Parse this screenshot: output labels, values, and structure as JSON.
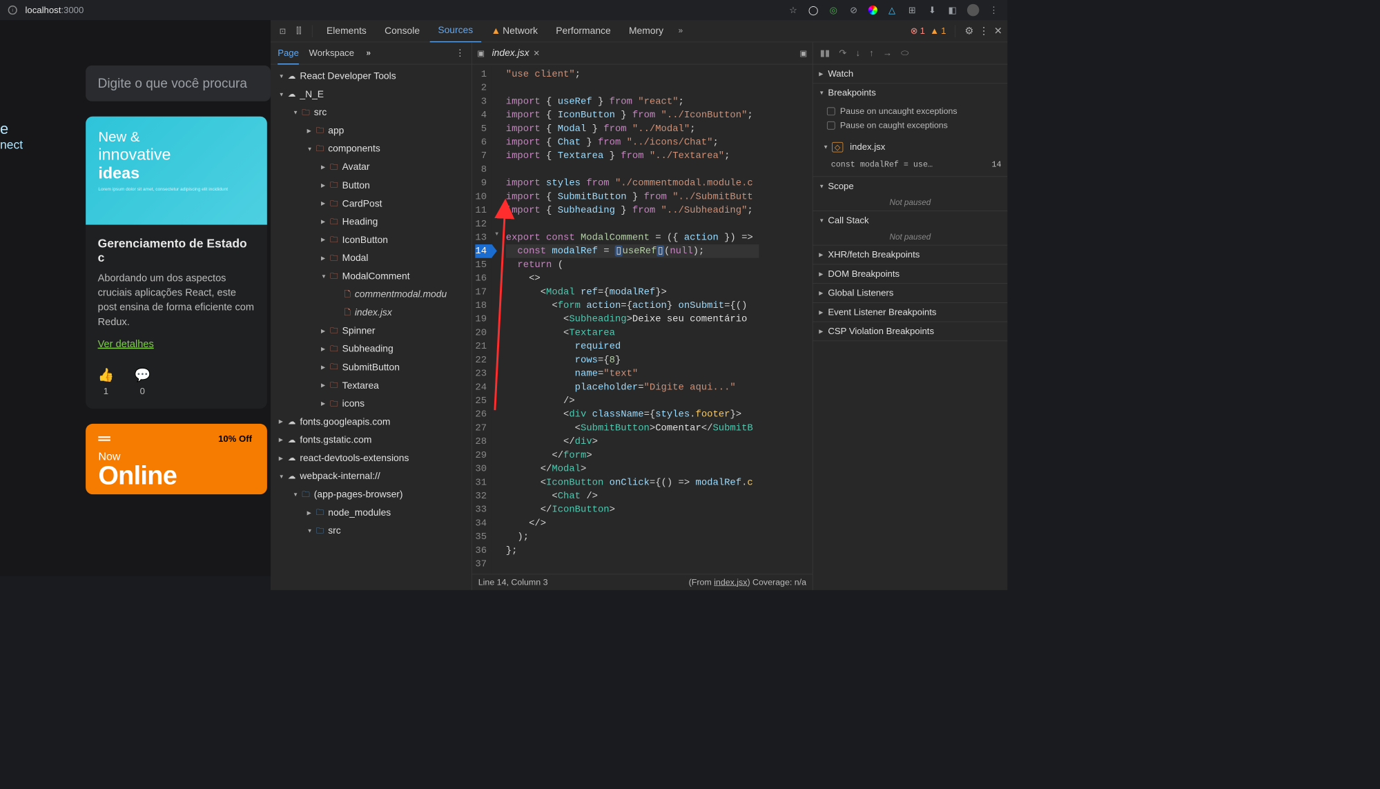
{
  "browser": {
    "url_host": "localhost",
    "url_port": ":3000",
    "icons": [
      "star",
      "circle",
      "target",
      "compass",
      "rgb",
      "triangle",
      "puzzle",
      "download",
      "panel",
      "avatar",
      "dots"
    ]
  },
  "page": {
    "logo_line1": "e",
    "logo_line2": "nect",
    "search_placeholder": "Digite o que você procura",
    "card1": {
      "hero_kicker": "New &",
      "hero_title_light": "innovative",
      "hero_title_bold": "ideas",
      "hero_fine": "Lorem ipsum dolor sit amet, consectetur adipiscing elit incididunt",
      "title": "Gerenciamento de Estado c",
      "body": "Abordando um dos aspectos cruciais aplicações React, este post ensina de forma eficiente com Redux.",
      "link": "Ver detalhes",
      "likes": "1",
      "comments": "0"
    },
    "card2": {
      "badge": "10% Off",
      "label": "Now",
      "big": "Online"
    }
  },
  "devtools": {
    "tabs": [
      "Elements",
      "Console",
      "Sources",
      "Network",
      "Performance",
      "Memory"
    ],
    "active_tab": "Sources",
    "network_warn": true,
    "errors": "1",
    "warnings": "1",
    "nav": {
      "tabs": [
        "Page",
        "Workspace"
      ],
      "active": "Page",
      "tree": [
        {
          "indent": 0,
          "open": true,
          "icon": "cloud",
          "label": "React Developer Tools"
        },
        {
          "indent": 0,
          "open": true,
          "icon": "cloud",
          "label": "_N_E"
        },
        {
          "indent": 1,
          "open": true,
          "icon": "folder",
          "label": "src"
        },
        {
          "indent": 2,
          "open": false,
          "icon": "folder",
          "label": "app"
        },
        {
          "indent": 2,
          "open": true,
          "icon": "folder",
          "label": "components"
        },
        {
          "indent": 3,
          "open": false,
          "icon": "folder",
          "label": "Avatar"
        },
        {
          "indent": 3,
          "open": false,
          "icon": "folder",
          "label": "Button"
        },
        {
          "indent": 3,
          "open": false,
          "icon": "folder",
          "label": "CardPost"
        },
        {
          "indent": 3,
          "open": false,
          "icon": "folder",
          "label": "Heading"
        },
        {
          "indent": 3,
          "open": false,
          "icon": "folder",
          "label": "IconButton"
        },
        {
          "indent": 3,
          "open": false,
          "icon": "folder",
          "label": "Modal"
        },
        {
          "indent": 3,
          "open": true,
          "icon": "folder",
          "label": "ModalComment"
        },
        {
          "indent": 4,
          "open": null,
          "icon": "file",
          "label": "commentmodal.modu",
          "ital": true
        },
        {
          "indent": 4,
          "open": null,
          "icon": "file",
          "label": "index.jsx",
          "ital": true
        },
        {
          "indent": 3,
          "open": false,
          "icon": "folder",
          "label": "Spinner"
        },
        {
          "indent": 3,
          "open": false,
          "icon": "folder",
          "label": "Subheading"
        },
        {
          "indent": 3,
          "open": false,
          "icon": "folder",
          "label": "SubmitButton"
        },
        {
          "indent": 3,
          "open": false,
          "icon": "folder",
          "label": "Textarea"
        },
        {
          "indent": 3,
          "open": false,
          "icon": "folder",
          "label": "icons"
        },
        {
          "indent": 0,
          "open": false,
          "icon": "cloud",
          "label": "fonts.googleapis.com"
        },
        {
          "indent": 0,
          "open": false,
          "icon": "cloud",
          "label": "fonts.gstatic.com"
        },
        {
          "indent": 0,
          "open": false,
          "icon": "cloud",
          "label": "react-devtools-extensions"
        },
        {
          "indent": 0,
          "open": true,
          "icon": "cloud",
          "label": "webpack-internal://"
        },
        {
          "indent": 1,
          "open": true,
          "icon": "folder-outline",
          "label": "(app-pages-browser)"
        },
        {
          "indent": 2,
          "open": false,
          "icon": "folder-outline",
          "label": "node_modules"
        },
        {
          "indent": 2,
          "open": true,
          "icon": "folder-outline",
          "label": "src"
        }
      ]
    },
    "editor": {
      "filename": "index.jsx",
      "status_left": "Line 14, Column 3",
      "status_right_prefix": "(From ",
      "status_right_link": "index.jsx",
      "status_right_suffix": ") Coverage: n/a",
      "breakpoint_line": 14,
      "fold_line": 13,
      "lines": [
        [
          {
            "t": "\"use client\"",
            "c": "str"
          },
          {
            "t": ";",
            "c": "punc"
          }
        ],
        [],
        [
          {
            "t": "import",
            "c": "kw"
          },
          {
            "t": " { ",
            "c": "punc"
          },
          {
            "t": "useRef",
            "c": "id"
          },
          {
            "t": " } ",
            "c": "punc"
          },
          {
            "t": "from",
            "c": "kw"
          },
          {
            "t": " ",
            "c": ""
          },
          {
            "t": "\"react\"",
            "c": "str"
          },
          {
            "t": ";",
            "c": "punc"
          }
        ],
        [
          {
            "t": "import",
            "c": "kw"
          },
          {
            "t": " { ",
            "c": "punc"
          },
          {
            "t": "IconButton",
            "c": "id"
          },
          {
            "t": " } ",
            "c": "punc"
          },
          {
            "t": "from",
            "c": "kw"
          },
          {
            "t": " ",
            "c": ""
          },
          {
            "t": "\"../IconButton\"",
            "c": "str"
          },
          {
            "t": ";",
            "c": "punc"
          }
        ],
        [
          {
            "t": "import",
            "c": "kw"
          },
          {
            "t": " { ",
            "c": "punc"
          },
          {
            "t": "Modal",
            "c": "id"
          },
          {
            "t": " } ",
            "c": "punc"
          },
          {
            "t": "from",
            "c": "kw"
          },
          {
            "t": " ",
            "c": ""
          },
          {
            "t": "\"../Modal\"",
            "c": "str"
          },
          {
            "t": ";",
            "c": "punc"
          }
        ],
        [
          {
            "t": "import",
            "c": "kw"
          },
          {
            "t": " { ",
            "c": "punc"
          },
          {
            "t": "Chat",
            "c": "id"
          },
          {
            "t": " } ",
            "c": "punc"
          },
          {
            "t": "from",
            "c": "kw"
          },
          {
            "t": " ",
            "c": ""
          },
          {
            "t": "\"../icons/Chat\"",
            "c": "str"
          },
          {
            "t": ";",
            "c": "punc"
          }
        ],
        [
          {
            "t": "import",
            "c": "kw"
          },
          {
            "t": " { ",
            "c": "punc"
          },
          {
            "t": "Textarea",
            "c": "id"
          },
          {
            "t": " } ",
            "c": "punc"
          },
          {
            "t": "from",
            "c": "kw"
          },
          {
            "t": " ",
            "c": ""
          },
          {
            "t": "\"../Textarea\"",
            "c": "str"
          },
          {
            "t": ";",
            "c": "punc"
          }
        ],
        [],
        [
          {
            "t": "import",
            "c": "kw"
          },
          {
            "t": " ",
            "c": ""
          },
          {
            "t": "styles",
            "c": "id"
          },
          {
            "t": " ",
            "c": ""
          },
          {
            "t": "from",
            "c": "kw"
          },
          {
            "t": " ",
            "c": ""
          },
          {
            "t": "\"./commentmodal.module.c",
            "c": "str"
          }
        ],
        [
          {
            "t": "import",
            "c": "kw"
          },
          {
            "t": " { ",
            "c": "punc"
          },
          {
            "t": "SubmitButton",
            "c": "id"
          },
          {
            "t": " } ",
            "c": "punc"
          },
          {
            "t": "from",
            "c": "kw"
          },
          {
            "t": " ",
            "c": ""
          },
          {
            "t": "\"../SubmitButt",
            "c": "str"
          }
        ],
        [
          {
            "t": "import",
            "c": "kw"
          },
          {
            "t": " { ",
            "c": "punc"
          },
          {
            "t": "Subheading",
            "c": "id"
          },
          {
            "t": " } ",
            "c": "punc"
          },
          {
            "t": "from",
            "c": "kw"
          },
          {
            "t": " ",
            "c": ""
          },
          {
            "t": "\"../Subheading\"",
            "c": "str"
          },
          {
            "t": ";",
            "c": "punc"
          }
        ],
        [],
        [
          {
            "t": "export",
            "c": "kw"
          },
          {
            "t": " ",
            "c": ""
          },
          {
            "t": "const",
            "c": "kw"
          },
          {
            "t": " ",
            "c": ""
          },
          {
            "t": "ModalComment",
            "c": "fn"
          },
          {
            "t": " = ({ ",
            "c": "punc"
          },
          {
            "t": "action",
            "c": "id"
          },
          {
            "t": " }) => ",
            "c": "punc"
          }
        ],
        [
          {
            "t": "  ",
            "c": ""
          },
          {
            "t": "const",
            "c": "kw"
          },
          {
            "t": " ",
            "c": ""
          },
          {
            "t": "modalRef",
            "c": "id"
          },
          {
            "t": " = ",
            "c": "punc"
          },
          {
            "t": "",
            "c": "pill"
          },
          {
            "t": "useRef",
            "c": "fn"
          },
          {
            "t": "",
            "c": "pill"
          },
          {
            "t": "(",
            "c": "punc"
          },
          {
            "t": "null",
            "c": "kw"
          },
          {
            "t": ");",
            "c": "punc"
          }
        ],
        [
          {
            "t": "  ",
            "c": ""
          },
          {
            "t": "return",
            "c": "kw"
          },
          {
            "t": " (",
            "c": "punc"
          }
        ],
        [
          {
            "t": "    <>",
            "c": "punc"
          }
        ],
        [
          {
            "t": "      <",
            "c": "punc"
          },
          {
            "t": "Modal",
            "c": "tag"
          },
          {
            "t": " ",
            "c": ""
          },
          {
            "t": "ref",
            "c": "attr"
          },
          {
            "t": "={",
            "c": "punc"
          },
          {
            "t": "modalRef",
            "c": "id"
          },
          {
            "t": "}>",
            "c": "punc"
          }
        ],
        [
          {
            "t": "        <",
            "c": "punc"
          },
          {
            "t": "form",
            "c": "tag"
          },
          {
            "t": " ",
            "c": ""
          },
          {
            "t": "action",
            "c": "attr"
          },
          {
            "t": "={",
            "c": "punc"
          },
          {
            "t": "action",
            "c": "id"
          },
          {
            "t": "} ",
            "c": "punc"
          },
          {
            "t": "onSubmit",
            "c": "attr"
          },
          {
            "t": "={()",
            "c": "punc"
          }
        ],
        [
          {
            "t": "          <",
            "c": "punc"
          },
          {
            "t": "Subheading",
            "c": "tag"
          },
          {
            "t": ">",
            "c": "punc"
          },
          {
            "t": "Deixe seu comentário",
            "c": ""
          }
        ],
        [
          {
            "t": "          <",
            "c": "punc"
          },
          {
            "t": "Textarea",
            "c": "tag"
          }
        ],
        [
          {
            "t": "            ",
            "c": ""
          },
          {
            "t": "required",
            "c": "attr"
          }
        ],
        [
          {
            "t": "            ",
            "c": ""
          },
          {
            "t": "rows",
            "c": "attr"
          },
          {
            "t": "={",
            "c": "punc"
          },
          {
            "t": "8",
            "c": "num"
          },
          {
            "t": "}",
            "c": "punc"
          }
        ],
        [
          {
            "t": "            ",
            "c": ""
          },
          {
            "t": "name",
            "c": "attr"
          },
          {
            "t": "=",
            "c": "punc"
          },
          {
            "t": "\"text\"",
            "c": "str"
          }
        ],
        [
          {
            "t": "            ",
            "c": ""
          },
          {
            "t": "placeholder",
            "c": "attr"
          },
          {
            "t": "=",
            "c": "punc"
          },
          {
            "t": "\"Digite aqui...\"",
            "c": "str"
          }
        ],
        [
          {
            "t": "          />",
            "c": "punc"
          }
        ],
        [
          {
            "t": "          <",
            "c": "punc"
          },
          {
            "t": "div",
            "c": "tag"
          },
          {
            "t": " ",
            "c": ""
          },
          {
            "t": "className",
            "c": "attr"
          },
          {
            "t": "={",
            "c": "punc"
          },
          {
            "t": "styles",
            "c": "id"
          },
          {
            "t": ".",
            "c": "punc"
          },
          {
            "t": "footer",
            "c": "prop"
          },
          {
            "t": "}>",
            "c": "punc"
          }
        ],
        [
          {
            "t": "            <",
            "c": "punc"
          },
          {
            "t": "SubmitButton",
            "c": "tag"
          },
          {
            "t": ">",
            "c": "punc"
          },
          {
            "t": "Comentar",
            "c": ""
          },
          {
            "t": "</",
            "c": "punc"
          },
          {
            "t": "SubmitB",
            "c": "tag"
          }
        ],
        [
          {
            "t": "          </",
            "c": "punc"
          },
          {
            "t": "div",
            "c": "tag"
          },
          {
            "t": ">",
            "c": "punc"
          }
        ],
        [
          {
            "t": "        </",
            "c": "punc"
          },
          {
            "t": "form",
            "c": "tag"
          },
          {
            "t": ">",
            "c": "punc"
          }
        ],
        [
          {
            "t": "      </",
            "c": "punc"
          },
          {
            "t": "Modal",
            "c": "tag"
          },
          {
            "t": ">",
            "c": "punc"
          }
        ],
        [
          {
            "t": "      <",
            "c": "punc"
          },
          {
            "t": "IconButton",
            "c": "tag"
          },
          {
            "t": " ",
            "c": ""
          },
          {
            "t": "onClick",
            "c": "attr"
          },
          {
            "t": "={() => ",
            "c": "punc"
          },
          {
            "t": "modalRef",
            "c": "id"
          },
          {
            "t": ".",
            "c": "punc"
          },
          {
            "t": "c",
            "c": "prop"
          }
        ],
        [
          {
            "t": "        <",
            "c": "punc"
          },
          {
            "t": "Chat",
            "c": "tag"
          },
          {
            "t": " />",
            "c": "punc"
          }
        ],
        [
          {
            "t": "      </",
            "c": "punc"
          },
          {
            "t": "IconButton",
            "c": "tag"
          },
          {
            "t": ">",
            "c": "punc"
          }
        ],
        [
          {
            "t": "    </>",
            "c": "punc"
          }
        ],
        [
          {
            "t": "  );",
            "c": "punc"
          }
        ],
        [
          {
            "t": "};",
            "c": "punc"
          }
        ],
        []
      ]
    },
    "right": {
      "sections": {
        "watch": "Watch",
        "breakpoints": "Breakpoints",
        "pause_uncaught": "Pause on uncaught exceptions",
        "pause_caught": "Pause on caught exceptions",
        "bp_file": "index.jsx",
        "bp_code": "const modalRef = use…",
        "bp_line": "14",
        "scope": "Scope",
        "not_paused": "Not paused",
        "callstack": "Call Stack",
        "xhr": "XHR/fetch Breakpoints",
        "dom": "DOM Breakpoints",
        "global": "Global Listeners",
        "event": "Event Listener Breakpoints",
        "csp": "CSP Violation Breakpoints"
      }
    }
  }
}
